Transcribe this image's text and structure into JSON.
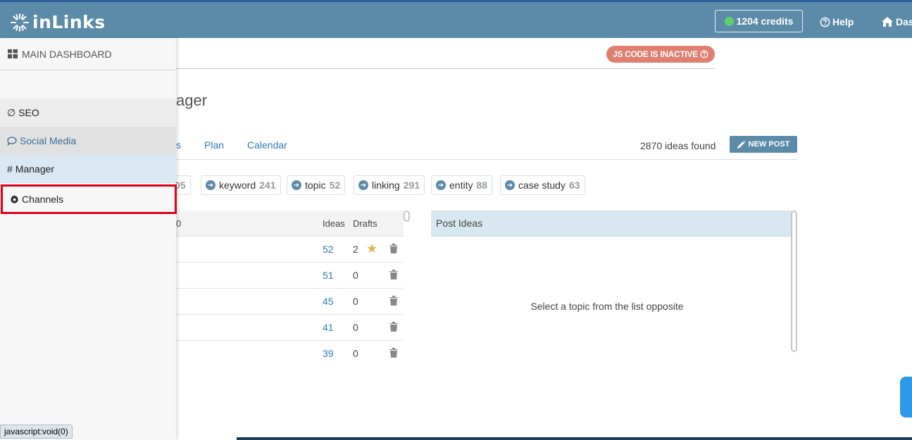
{
  "header": {
    "logo_text": "inLinks",
    "credits": "1204 credits",
    "help": "Help",
    "dashboard": "Das",
    "brand_color": "#5b8ba8"
  },
  "main": {
    "js_badge": "JS CODE IS INACTIVE",
    "title_fragment": "ager",
    "tabs": [
      {
        "label": "s"
      },
      {
        "label": "Plan"
      },
      {
        "label": "Calendar"
      }
    ],
    "ideas_found": "2870 ideas found",
    "new_post": "NEW POST",
    "chips": [
      {
        "label": "",
        "count": "05"
      },
      {
        "label": "keyword",
        "count": "241"
      },
      {
        "label": "topic",
        "count": "52"
      },
      {
        "label": "linking",
        "count": "291"
      },
      {
        "label": "entity",
        "count": "88"
      },
      {
        "label": "case study",
        "count": "63"
      }
    ],
    "table": {
      "headers": {
        "first": "0",
        "ideas": "Ideas",
        "drafts": "Drafts"
      },
      "rows": [
        {
          "ideas": "52",
          "drafts": "2",
          "starred": true
        },
        {
          "ideas": "51",
          "drafts": "0",
          "starred": false
        },
        {
          "ideas": "45",
          "drafts": "0",
          "starred": false
        },
        {
          "ideas": "41",
          "drafts": "0",
          "starred": false
        },
        {
          "ideas": "39",
          "drafts": "0",
          "starred": false
        }
      ]
    },
    "post_ideas": {
      "header": "Post Ideas",
      "message": "Select a topic from the list opposite"
    }
  },
  "sidepanel": {
    "main_dashboard": "MAIN DASHBOARD",
    "items": [
      {
        "label": "SEO"
      },
      {
        "label": "Social Media"
      },
      {
        "label": "Manager"
      },
      {
        "label": "Channels"
      }
    ]
  },
  "statusbar": "javascript:void(0)"
}
